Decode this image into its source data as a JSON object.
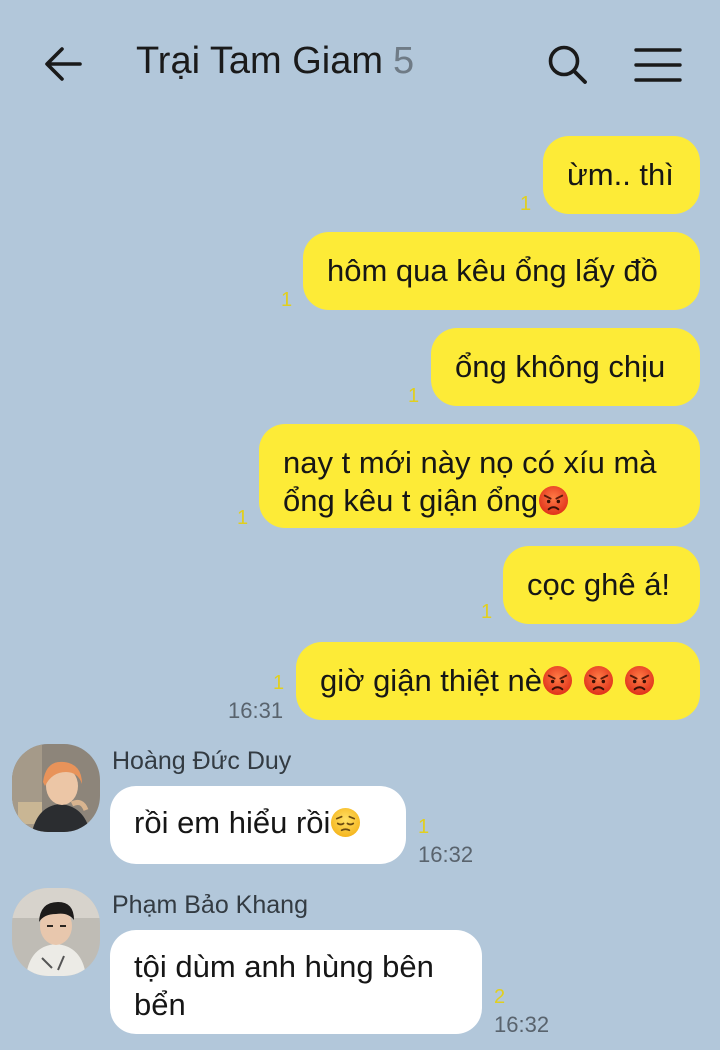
{
  "header": {
    "title": "Trại Tam Giam",
    "member_count": "5",
    "back_icon": "arrow-left-icon",
    "search_icon": "search-icon",
    "menu_icon": "hamburger-menu-icon"
  },
  "colors": {
    "background": "#b2c7da",
    "my_bubble": "#fdeb37",
    "their_bubble": "#ffffff",
    "unread_count": "#e1cf1f"
  },
  "messages_out": [
    {
      "text": "ừm.. thì",
      "unread": "1"
    },
    {
      "text": "hôm qua kêu ổng lấy đồ",
      "unread": "1"
    },
    {
      "text": "ổng không chịu",
      "unread": "1"
    },
    {
      "line1": "nay t mới này nọ có xíu mà",
      "line2": "ổng kêu t giận ổng",
      "emoji": "angry-face-emoji",
      "unread": "1"
    },
    {
      "text": "cọc ghê á!",
      "unread": "1"
    },
    {
      "text": "giờ giận thiệt nè",
      "emoji": "angry-face-emoji x3",
      "unread": "1",
      "time": "16:31"
    }
  ],
  "messages_in": [
    {
      "sender": "Hoàng Đức Duy",
      "avatar": "user-avatar-photo",
      "text": "rồi em hiểu rồi",
      "emoji": "pensive-face-emoji",
      "unread": "1",
      "time": "16:32"
    },
    {
      "sender": "Phạm Bảo Khang",
      "avatar": "user-avatar-photo",
      "line1": "tội dùm anh hùng bên",
      "line2": "bển",
      "unread": "2",
      "time": "16:32"
    }
  ]
}
